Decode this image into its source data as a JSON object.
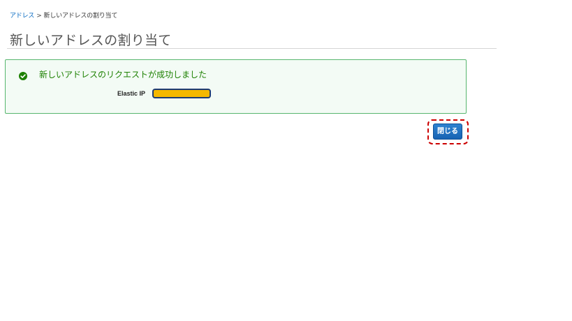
{
  "breadcrumb": {
    "parent": "アドレス",
    "separator": ">",
    "current": "新しいアドレスの割り当て"
  },
  "page": {
    "title": "新しいアドレスの割り当て"
  },
  "alert": {
    "status": "success",
    "icon": "check-circle-icon",
    "message": "新しいアドレスのリクエストが成功しました",
    "fields": {
      "elastic_ip_label": "Elastic IP",
      "elastic_ip_value": ""
    }
  },
  "actions": {
    "close_label": "閉じる"
  },
  "colors": {
    "success_green": "#1d8102",
    "success_border": "#57b66e",
    "link_blue": "#0066c0",
    "primary_button": "#1763b3",
    "redaction_fill": "#f6b800",
    "highlight_red": "#cc0000"
  }
}
